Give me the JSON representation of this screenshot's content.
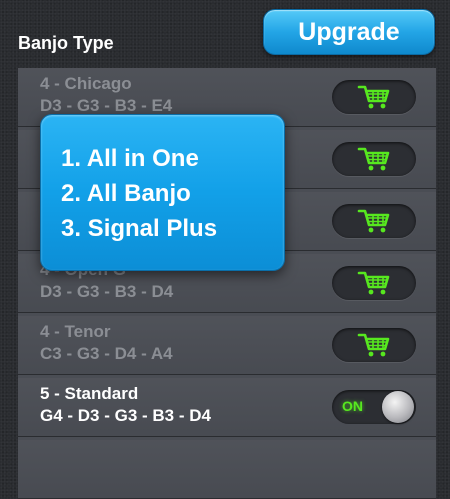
{
  "header": {
    "title": "Banjo Type",
    "upgrade_label": "Upgrade"
  },
  "rows": [
    {
      "name": "4 - Chicago",
      "notes": "D3 - G3 - B3 - E4",
      "action": "cart"
    },
    {
      "name": "",
      "notes": "",
      "action": "cart"
    },
    {
      "name": "",
      "notes": "",
      "action": "cart"
    },
    {
      "name": "4 - Open G",
      "notes": "D3 - G3 - B3 - D4",
      "action": "cart"
    },
    {
      "name": "4 - Tenor",
      "notes": "C3 - G3 - D4 - A4",
      "action": "cart"
    },
    {
      "name": "5 - Standard",
      "notes": "G4 - D3 - G3 - B3 - D4",
      "action": "toggle",
      "toggle_label": "ON"
    }
  ],
  "popup": {
    "lines": [
      "1. All in One",
      "2. All Banjo",
      "3. Signal Plus"
    ]
  },
  "colors": {
    "accent_blue": "#12a0e8",
    "cart_green": "#57e81f",
    "list_bg": "#4a4d54",
    "page_bg": "#2a2c30"
  },
  "icons": {
    "cart": "shopping-cart-icon"
  }
}
